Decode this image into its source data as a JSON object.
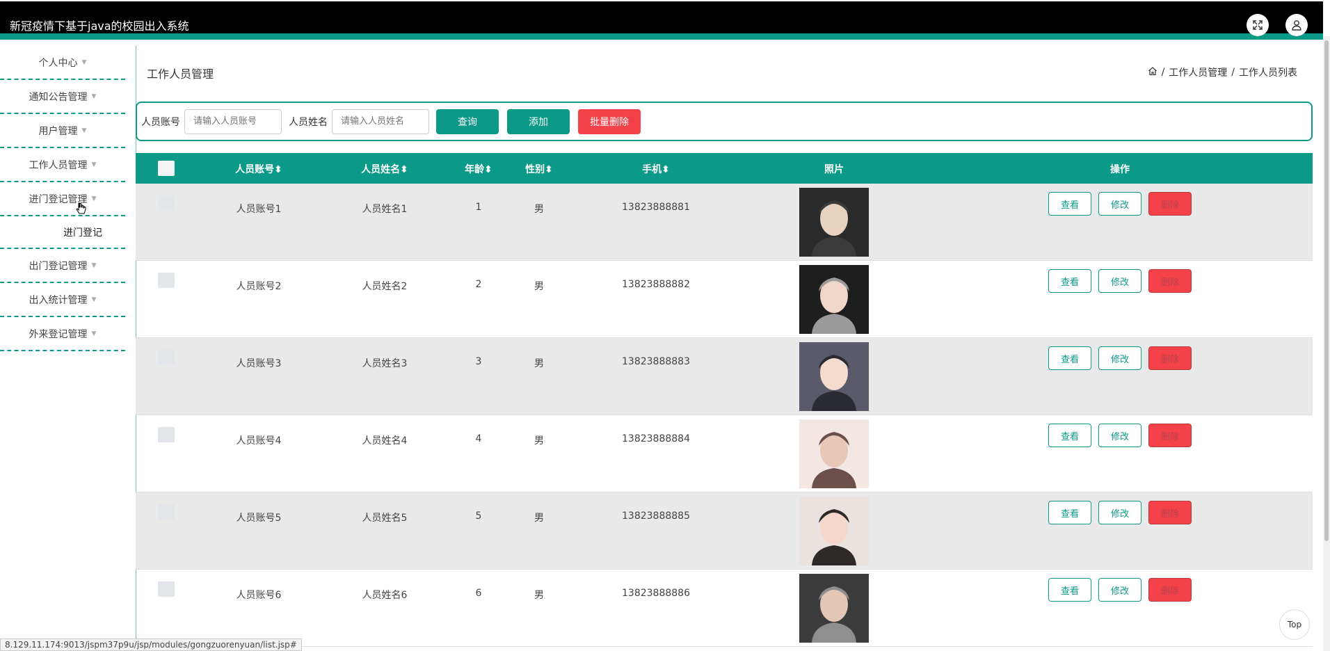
{
  "app": {
    "title": "新冠疫情下基于java的校园出入系统"
  },
  "topbar_icons": [
    "fullscreen-icon",
    "user-icon"
  ],
  "sidebar": {
    "items": [
      {
        "label": "个人中心"
      },
      {
        "label": "通知公告管理"
      },
      {
        "label": "用户管理"
      },
      {
        "label": "工作人员管理"
      },
      {
        "label": "进门登记管理"
      },
      {
        "label": "出门登记管理"
      },
      {
        "label": "出入统计管理"
      },
      {
        "label": "外来登记管理"
      }
    ],
    "sub_item": "进门登记"
  },
  "page": {
    "title": "工作人员管理",
    "breadcrumb": [
      "工作人员管理",
      "工作人员列表"
    ]
  },
  "search": {
    "account_label": "人员账号",
    "account_placeholder": "请输入人员账号",
    "name_label": "人员姓名",
    "name_placeholder": "请输入人员姓名",
    "query_label": "查询",
    "add_label": "添加",
    "batch_delete_label": "批量删除"
  },
  "table": {
    "headers": {
      "account": "人员账号",
      "name": "人员姓名",
      "age": "年龄",
      "gender": "性别",
      "phone": "手机",
      "photo": "照片",
      "actions": "操作"
    },
    "rows": [
      {
        "account": "人员账号1",
        "name": "人员姓名1",
        "age": "1",
        "gender": "男",
        "phone": "13823888881"
      },
      {
        "account": "人员账号2",
        "name": "人员姓名2",
        "age": "2",
        "gender": "男",
        "phone": "13823888882"
      },
      {
        "account": "人员账号3",
        "name": "人员姓名3",
        "age": "3",
        "gender": "男",
        "phone": "13823888883"
      },
      {
        "account": "人员账号4",
        "name": "人员姓名4",
        "age": "4",
        "gender": "男",
        "phone": "13823888884"
      },
      {
        "account": "人员账号5",
        "name": "人员姓名5",
        "age": "5",
        "gender": "男",
        "phone": "13823888885"
      },
      {
        "account": "人员账号6",
        "name": "人员姓名6",
        "age": "6",
        "gender": "男",
        "phone": "13823888886"
      }
    ],
    "actions": {
      "view": "查看",
      "edit": "修改",
      "delete": "删除"
    }
  },
  "status_url": "8.129.11.174:9013/jspm37p9u/jsp/modules/gongzuorenyuan/list.jsp#",
  "top_button": "Top",
  "colors": {
    "accent": "#0c9a88",
    "danger": "#f5424a",
    "topbar": "#000000"
  }
}
